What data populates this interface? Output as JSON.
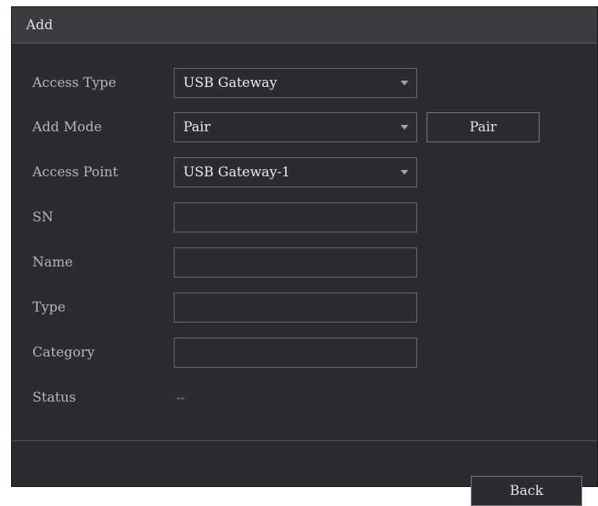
{
  "dialog": {
    "title": "Add"
  },
  "form": {
    "access_type": {
      "label": "Access Type",
      "value": "USB Gateway"
    },
    "add_mode": {
      "label": "Add Mode",
      "value": "Pair",
      "button": "Pair"
    },
    "access_point": {
      "label": "Access Point",
      "value": "USB Gateway-1"
    },
    "sn": {
      "label": "SN",
      "value": ""
    },
    "name": {
      "label": "Name",
      "value": ""
    },
    "type": {
      "label": "Type",
      "value": ""
    },
    "category": {
      "label": "Category",
      "value": ""
    },
    "status": {
      "label": "Status",
      "value": "--"
    }
  },
  "footer": {
    "back": "Back"
  },
  "colors": {
    "dialog_bg": "#2b2c31",
    "titlebar_bg": "#3a3b41",
    "label_text": "#b5b6bb",
    "value_text": "#ececee",
    "field_border": "#6b6c72"
  },
  "icons": {
    "dropdown": "chevron-down-icon"
  }
}
